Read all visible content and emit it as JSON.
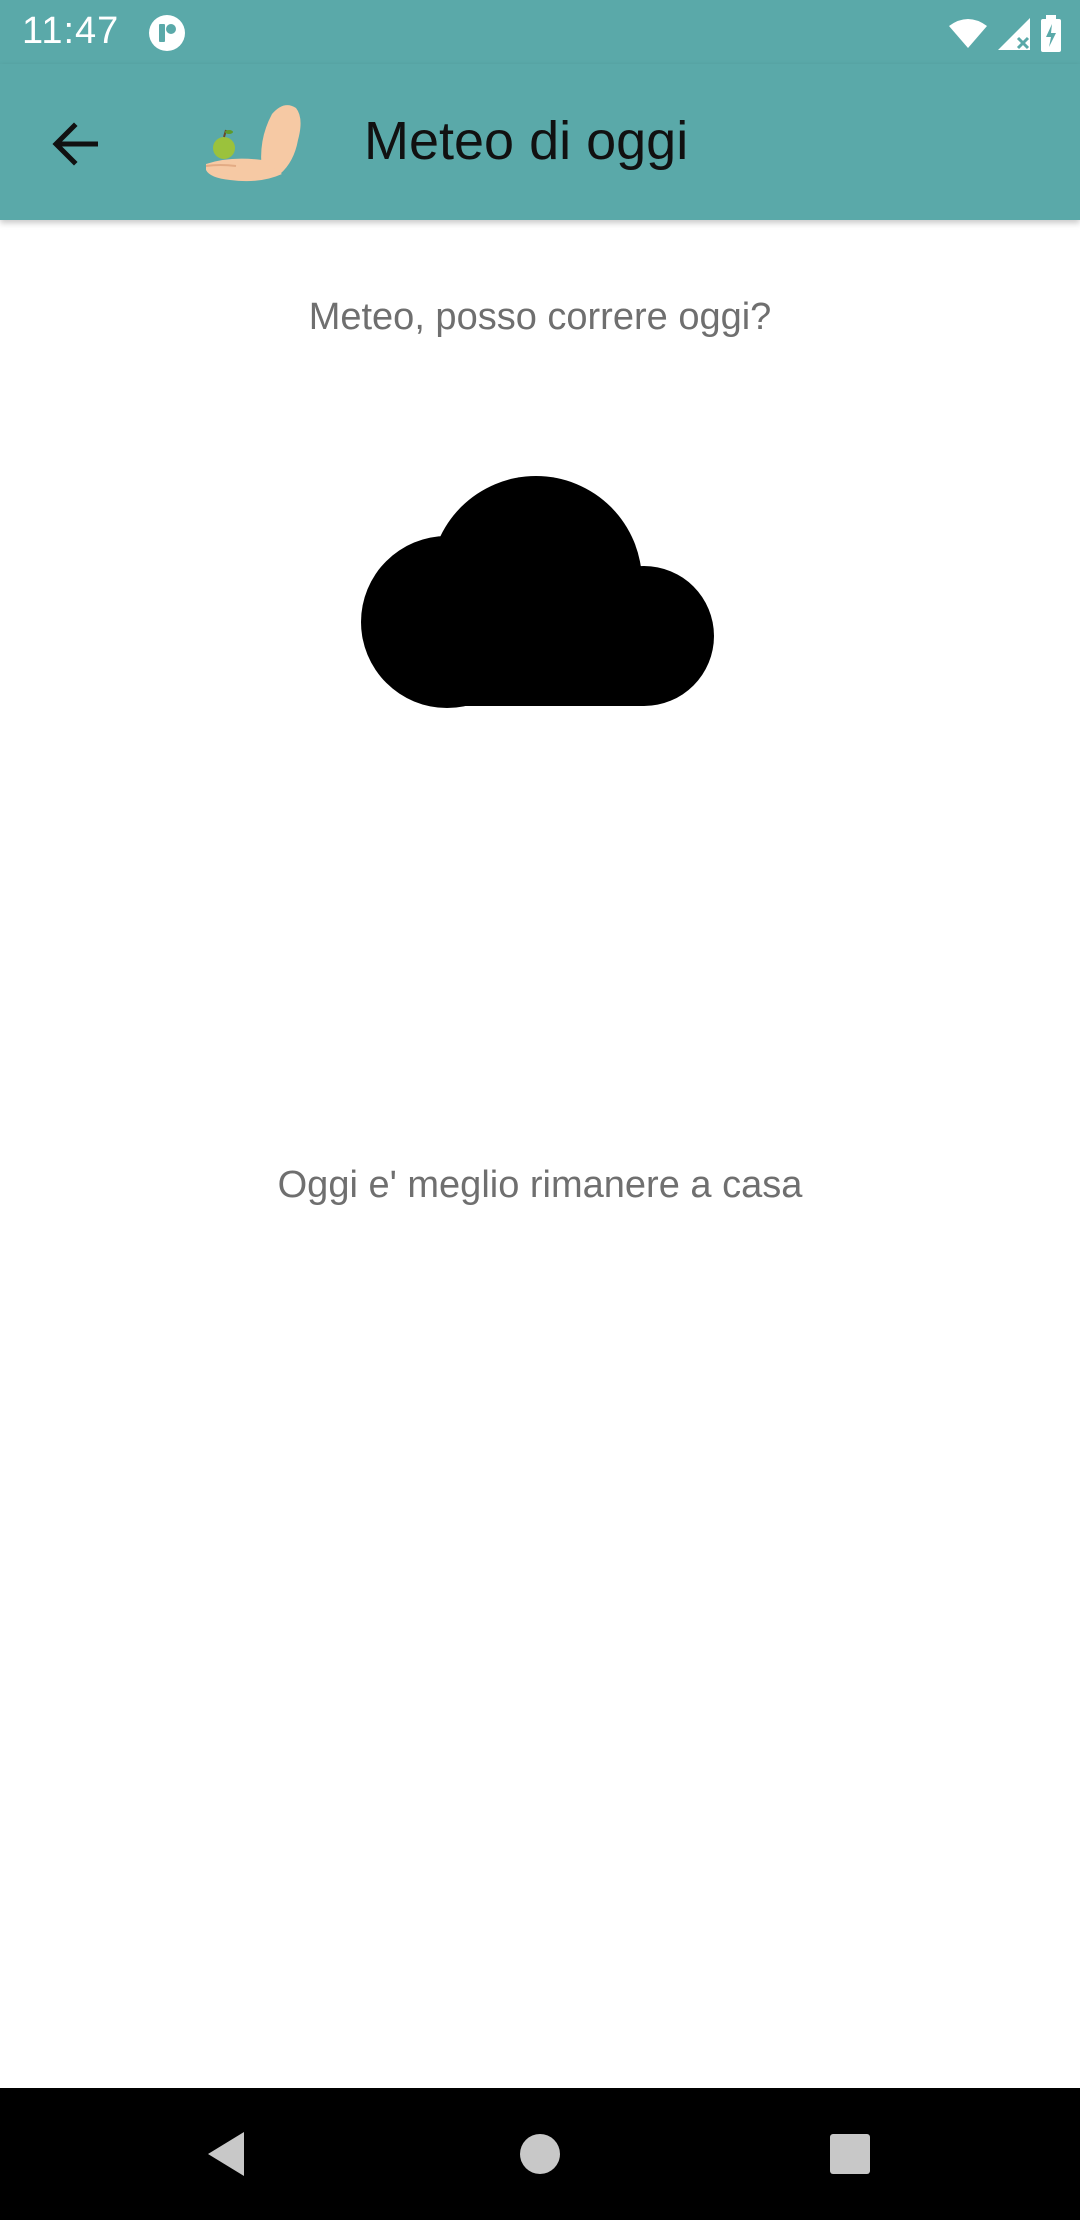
{
  "status_bar": {
    "time": "11:47",
    "icons": [
      "notification-icon",
      "wifi-icon",
      "signal-icon",
      "battery-charging-icon"
    ]
  },
  "app_bar": {
    "title": "Meteo di oggi",
    "back_icon": "arrow-back-icon",
    "logo": "arm-apple-logo",
    "background_color": "#5aa9a9"
  },
  "main": {
    "question": "Meteo, posso correre oggi?",
    "weather_icon": "cloud-icon",
    "result": "Oggi e' meglio rimanere a casa"
  },
  "nav_bar": {
    "buttons": [
      "back-triangle-icon",
      "home-circle-icon",
      "recents-square-icon"
    ]
  }
}
